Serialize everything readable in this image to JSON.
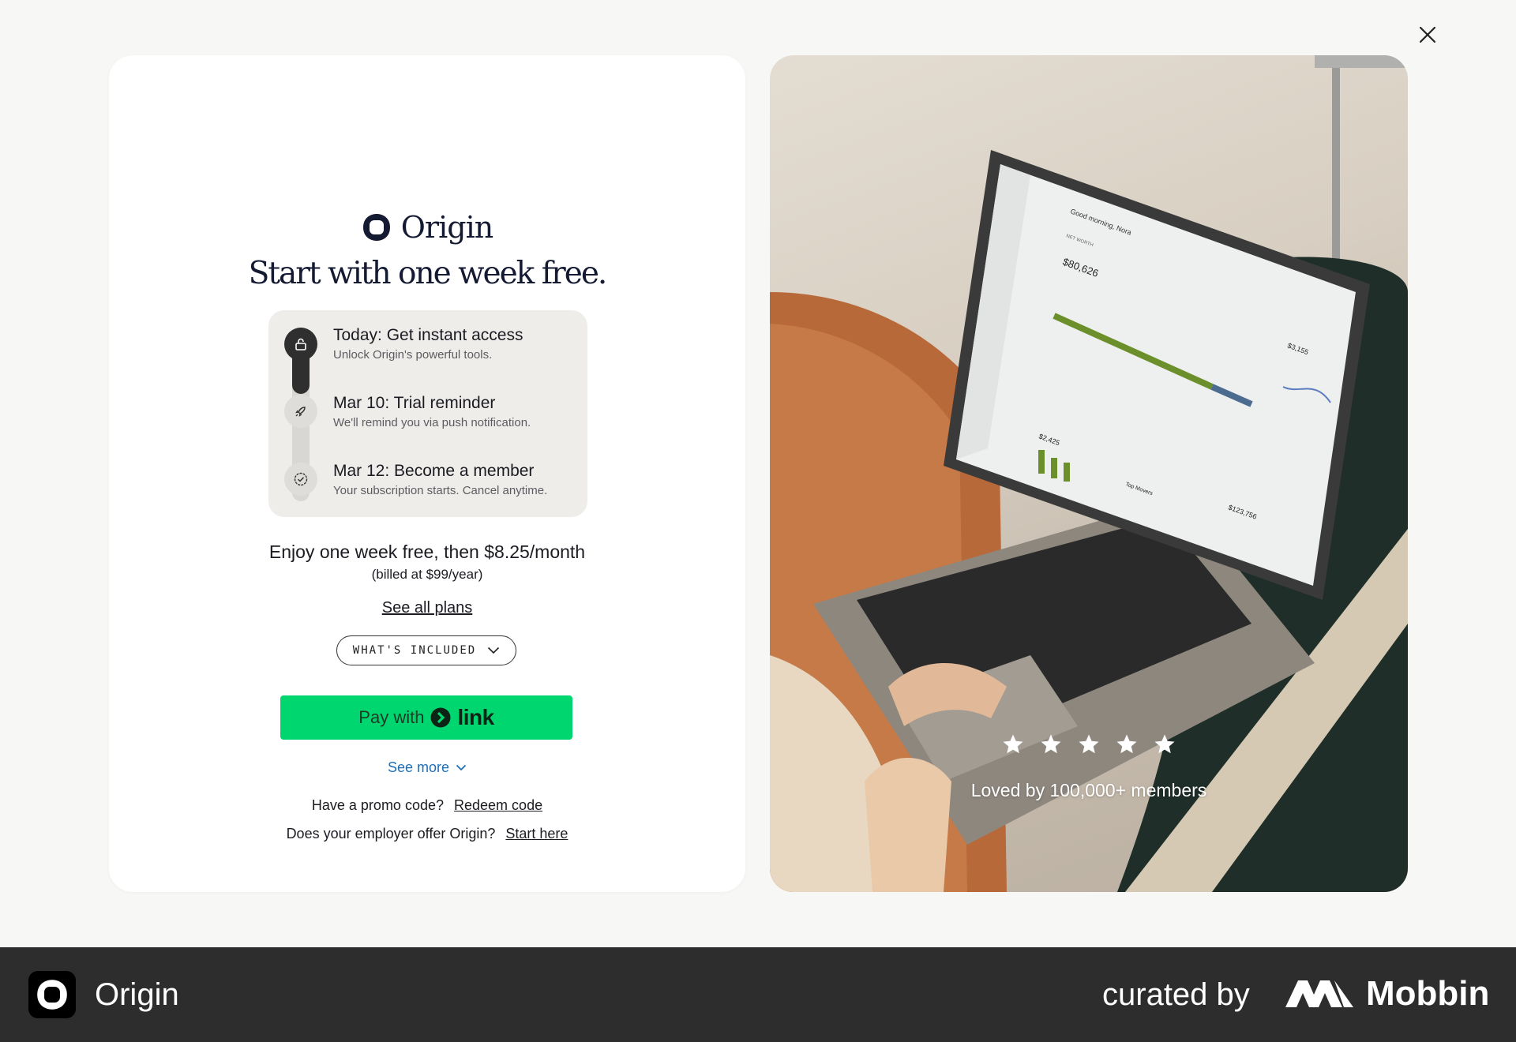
{
  "brand": {
    "name": "Origin"
  },
  "hero": {
    "headline": "Start with one week free."
  },
  "timeline": [
    {
      "title": "Today: Get instant access",
      "subtitle": "Unlock Origin's powerful tools.",
      "icon": "lock-icon"
    },
    {
      "title": "Mar 10: Trial reminder",
      "subtitle": "We'll remind you via push notification.",
      "icon": "rocket-icon"
    },
    {
      "title": "Mar 12: Become a member",
      "subtitle": "Your subscription starts. Cancel anytime.",
      "icon": "check-badge-icon"
    }
  ],
  "pricing": {
    "line": "Enjoy one week free, then $8.25/month",
    "billed": "(billed at $99/year)",
    "see_plans": "See all plans",
    "included": "WHAT'S INCLUDED"
  },
  "payment": {
    "pay_label": "Pay with",
    "link_label": "link",
    "see_more": "See more"
  },
  "promo": {
    "question": "Have a promo code?",
    "action": "Redeem code"
  },
  "employer": {
    "question": "Does your employer offer Origin?",
    "action": "Start here"
  },
  "photo": {
    "rating_stars": 5,
    "caption": "Loved by 100,000+ members",
    "laptop_screen": {
      "greeting": "Good morning, Nora",
      "net_worth_label": "NET WORTH",
      "net_worth_value": "$80,626",
      "spending_value": "$3,155",
      "cashflow_value": "$2,425",
      "investments_value": "$123,756",
      "top_movers": "Top Movers"
    }
  },
  "footer": {
    "app_name": "Origin",
    "curated_by": "curated by",
    "mobbin": "Mobbin"
  },
  "colors": {
    "pay_green": "#00d66f",
    "link_blue": "#1f6fb5",
    "footer_bg": "#2d2d2d"
  }
}
